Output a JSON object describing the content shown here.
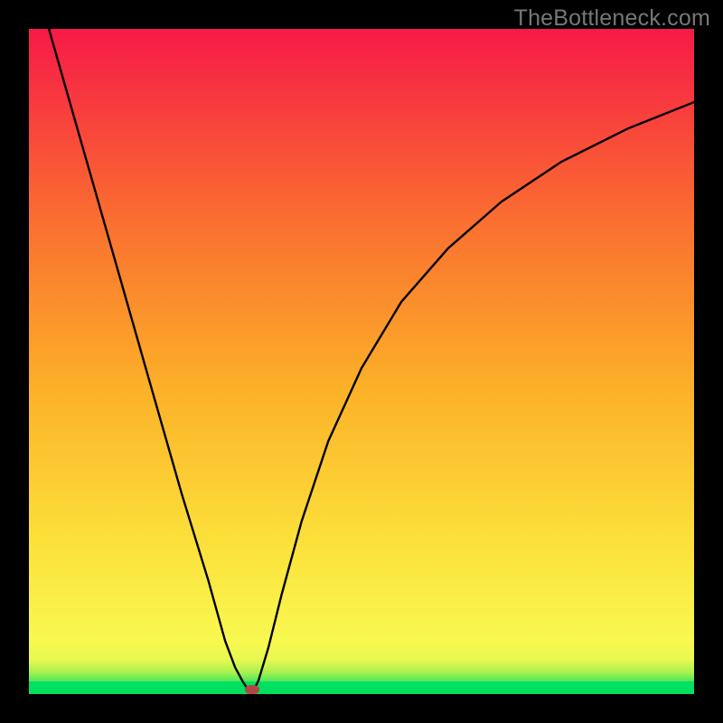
{
  "watermark": "TheBottleneck.com",
  "colors": {
    "frame": "#000000",
    "gradient_top": "#f61a48",
    "gradient_mid": "#fcb028",
    "gradient_yellow": "#f8f850",
    "gradient_green": "#00e060",
    "curve": "#000000",
    "marker": "#b34545"
  },
  "chart_data": {
    "type": "line",
    "title": "",
    "xlabel": "",
    "ylabel": "",
    "xlim": [
      0,
      1
    ],
    "ylim": [
      0,
      1
    ],
    "grid": false,
    "series": [
      {
        "name": "left-branch",
        "x": [
          0.03,
          0.07,
          0.11,
          0.15,
          0.19,
          0.23,
          0.27,
          0.295,
          0.31,
          0.322,
          0.33,
          0.335
        ],
        "values": [
          1.0,
          0.86,
          0.72,
          0.58,
          0.44,
          0.3,
          0.17,
          0.08,
          0.04,
          0.018,
          0.006,
          0.0
        ]
      },
      {
        "name": "right-branch",
        "x": [
          0.335,
          0.345,
          0.36,
          0.38,
          0.41,
          0.45,
          0.5,
          0.56,
          0.63,
          0.71,
          0.8,
          0.9,
          1.0
        ],
        "values": [
          0.0,
          0.02,
          0.07,
          0.15,
          0.26,
          0.38,
          0.49,
          0.59,
          0.67,
          0.74,
          0.8,
          0.85,
          0.89
        ]
      }
    ],
    "annotations": [
      {
        "name": "min-marker",
        "x": 0.335,
        "y": 0.007
      }
    ]
  }
}
